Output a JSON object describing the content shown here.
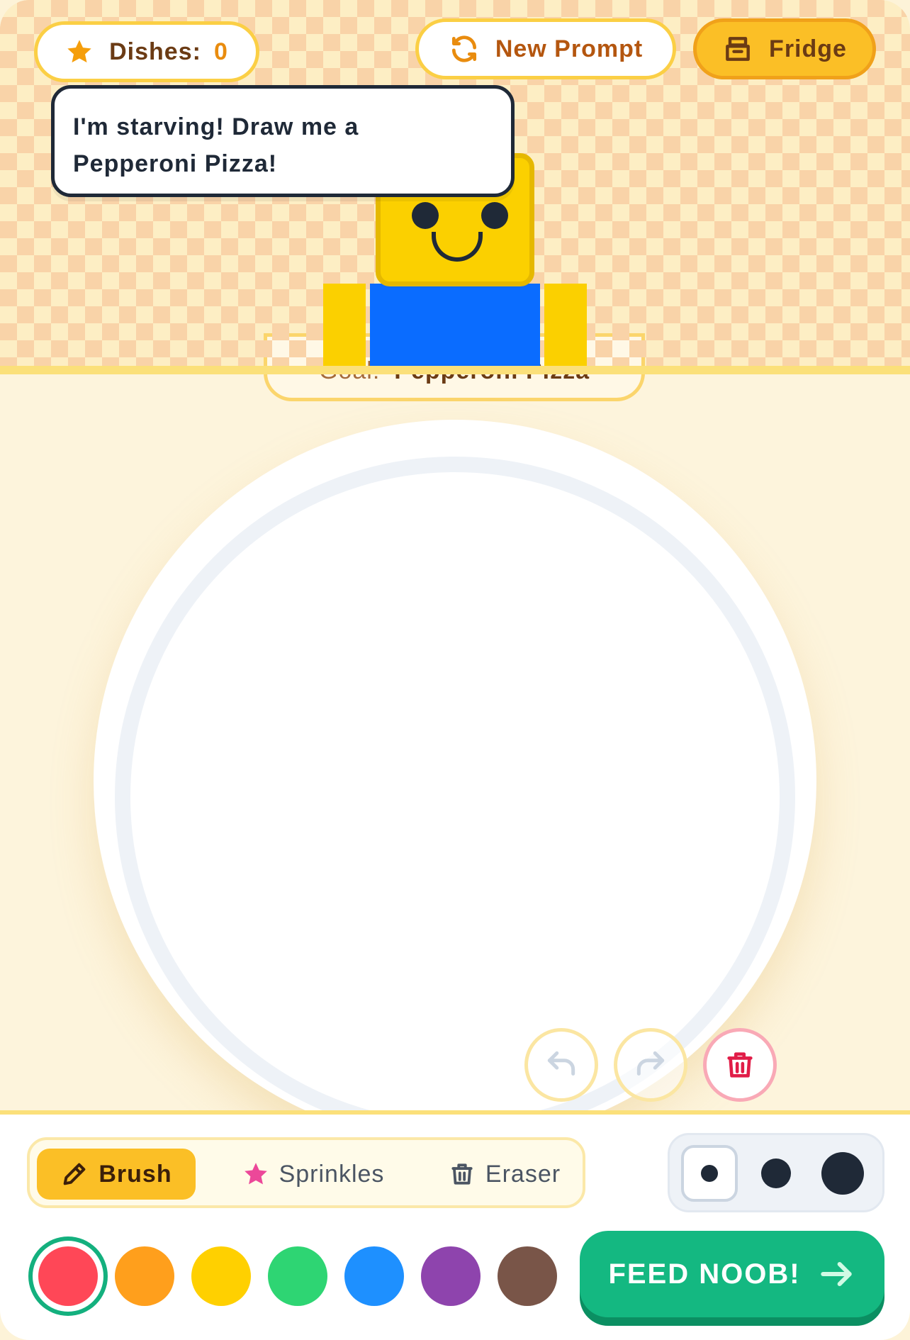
{
  "header": {
    "dishes_label": "Dishes:",
    "dishes_count": "0",
    "new_prompt_label": "New Prompt",
    "fridge_label": "Fridge"
  },
  "speech": {
    "line1": "I'm starving! Draw me a",
    "line2": "Pepperoni Pizza!"
  },
  "goal": {
    "label": "Goal:",
    "value": "Pepperoni Pizza"
  },
  "canvas_actions": {
    "undo_icon": "undo-icon",
    "redo_icon": "redo-icon",
    "clear_icon": "trash-icon"
  },
  "tools": [
    {
      "label": "Brush",
      "icon": "pencil-icon",
      "selected": true
    },
    {
      "label": "Sprinkles",
      "icon": "star-icon",
      "selected": false
    },
    {
      "label": "Eraser",
      "icon": "trash-icon",
      "selected": false
    }
  ],
  "brush_sizes": [
    {
      "size": "small",
      "selected": true
    },
    {
      "size": "medium",
      "selected": false
    },
    {
      "size": "large",
      "selected": false
    }
  ],
  "palette": [
    {
      "name": "red",
      "color": "#ff4757",
      "selected": true
    },
    {
      "name": "orange",
      "color": "#ff9f1c",
      "selected": false
    },
    {
      "name": "yellow",
      "color": "#ffd000",
      "selected": false
    },
    {
      "name": "green",
      "color": "#2ed573",
      "selected": false
    },
    {
      "name": "blue",
      "color": "#1e90ff",
      "selected": false
    },
    {
      "name": "purple",
      "color": "#8e44ad",
      "selected": false
    },
    {
      "name": "brown",
      "color": "#795548",
      "selected": false
    }
  ],
  "feed_button": {
    "label": "FEED NOOB!"
  },
  "colors": {
    "accent": "#fbbf26",
    "primary_action": "#14b881",
    "character_head": "#fbd000",
    "character_shirt": "#0a6cff"
  }
}
